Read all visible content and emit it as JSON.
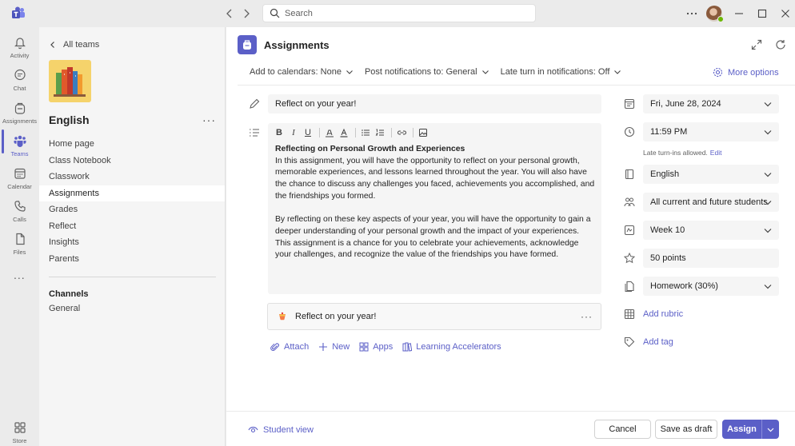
{
  "search": {
    "placeholder": "Search"
  },
  "rail": {
    "items": [
      {
        "label": "Activity",
        "icon": "bell-icon"
      },
      {
        "label": "Chat",
        "icon": "chat-icon"
      },
      {
        "label": "Assignments",
        "icon": "backpack-icon"
      },
      {
        "label": "Teams",
        "icon": "teams-icon"
      },
      {
        "label": "Calendar",
        "icon": "calendar-icon"
      },
      {
        "label": "Calls",
        "icon": "phone-icon"
      },
      {
        "label": "Files",
        "icon": "file-icon"
      }
    ],
    "more": "...",
    "store": "Store"
  },
  "team_panel": {
    "back_label": "All teams",
    "team_name": "English",
    "nav": [
      "Home page",
      "Class Notebook",
      "Classwork",
      "Assignments",
      "Grades",
      "Reflect",
      "Insights",
      "Parents"
    ],
    "selected": "Assignments",
    "channels_heading": "Channels",
    "channels": [
      "General"
    ]
  },
  "main": {
    "title": "Assignments",
    "options": {
      "calendars": "Add to calendars: None",
      "notifications": "Post notifications to: General",
      "late": "Late turn in notifications: Off",
      "more": "More options"
    },
    "assignment_title": "Reflect on your year!",
    "editor": {
      "heading": "Reflecting on Personal Growth and Experiences",
      "para1": "In this assignment, you will have the opportunity to reflect on your personal growth, memorable experiences, and lessons learned throughout the year. You will also have the chance to discuss any challenges you faced, achievements you accomplished, and the friendships you formed.",
      "para2": "By reflecting on these key aspects of your year, you will have the opportunity to gain a deeper understanding of your personal growth and the impact of your experiences. This assignment is a chance for you to celebrate your achievements, acknowledge your challenges, and recognize the value of the friendships you have formed."
    },
    "attachment": {
      "name": "Reflect on your year!"
    },
    "actions": {
      "attach": "Attach",
      "new": "New",
      "apps": "Apps",
      "accelerators": "Learning Accelerators"
    }
  },
  "right": {
    "due_date": "Fri, June 28, 2024",
    "due_time": "11:59 PM",
    "late_text": "Late turn-ins allowed.",
    "late_edit": "Edit",
    "class": "English",
    "students": "All current and future students",
    "module": "Week 10",
    "points": "50 points",
    "category": "Homework (30%)",
    "add_rubric": "Add rubric",
    "add_tag": "Add tag"
  },
  "footer": {
    "student_view": "Student view",
    "cancel": "Cancel",
    "save_draft": "Save as draft",
    "assign": "Assign"
  },
  "colors": {
    "accent": "#5b5fc7"
  }
}
